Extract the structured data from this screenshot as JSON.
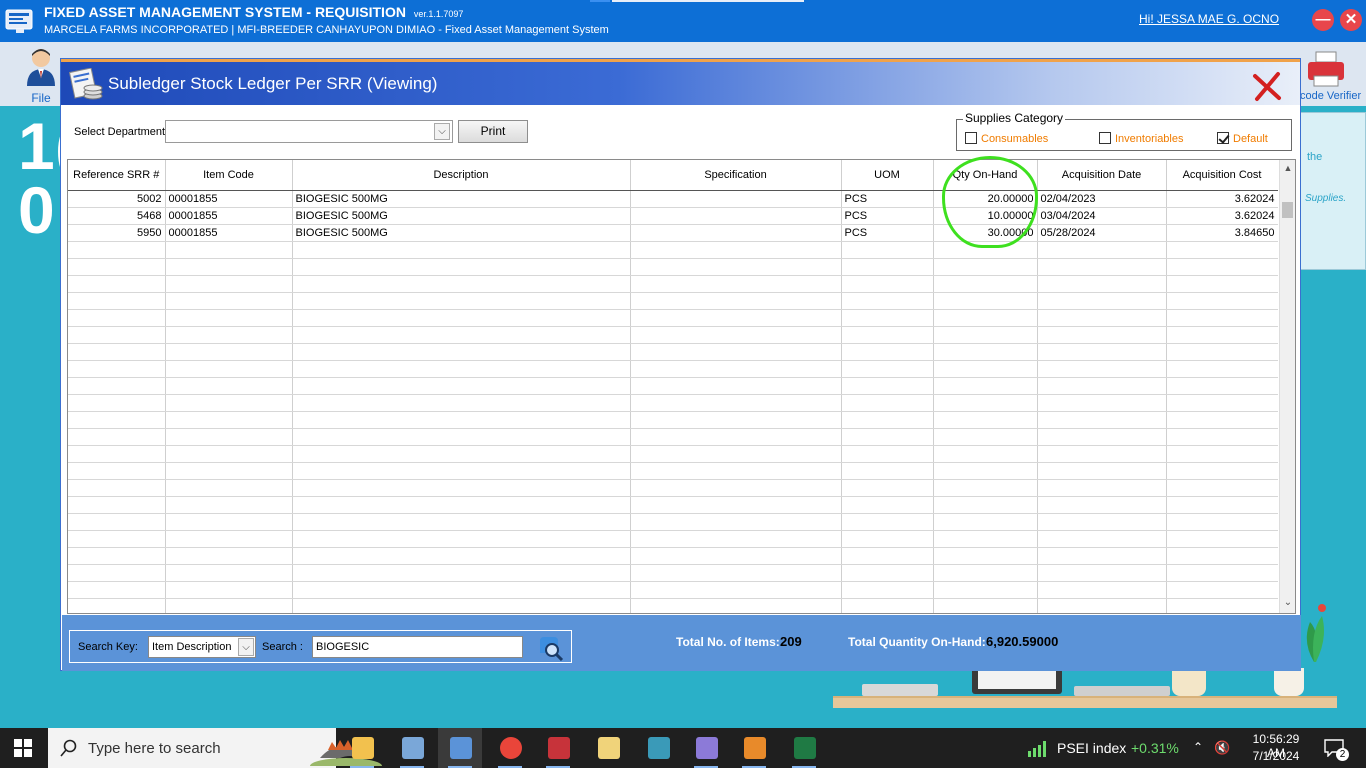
{
  "app": {
    "title": "FIXED ASSET MANAGEMENT SYSTEM - REQUISITION",
    "version": "ver.1.1.7097",
    "subtitle": "MARCELA FARMS INCORPORATED | MFI-BREEDER CANHAYUPON DIMIAO - Fixed Asset Management System",
    "greeting": "Hi! JESSA MAE G. OCNO",
    "minimize_glyph": "—",
    "close_glyph": "✕"
  },
  "ribbon": {
    "file_label": "File",
    "right_label": "code Verifier"
  },
  "background": {
    "num_1": "1(",
    "num_2": "0",
    "hint_1": "the",
    "hint_2": "Supplies."
  },
  "modal": {
    "title": "Subledger Stock Ledger Per SRR (Viewing)",
    "department_label": "Select Department",
    "department_value": "",
    "print_label": "Print",
    "category": {
      "legend": "Supplies Category",
      "consumables": "Consumables",
      "inventoriables": "Inventoriables",
      "default": "Default",
      "consumables_checked": false,
      "inventoriables_checked": false,
      "default_checked": true
    },
    "columns": [
      "Reference SRR #",
      "Item Code",
      "Description",
      "Specification",
      "UOM",
      "Qty On-Hand",
      "Acquisition Date",
      "Acquisition Cost"
    ],
    "rows": [
      [
        "5002",
        "00001855",
        "BIOGESIC 500MG",
        "",
        "PCS",
        "20.00000",
        "02/04/2023",
        "3.62024"
      ],
      [
        "5468",
        "00001855",
        "BIOGESIC 500MG",
        "",
        "PCS",
        "10.00000",
        "03/04/2024",
        "3.62024"
      ],
      [
        "5950",
        "00001855",
        "BIOGESIC 500MG",
        "",
        "PCS",
        "30.00000",
        "05/28/2024",
        "3.84650"
      ]
    ],
    "empty_rows": 22,
    "footer": {
      "search_key_label": "Search Key:",
      "search_key_value": "Item Description",
      "search_label": "Search :",
      "search_value": "BIOGESIC",
      "total_items_label": "Total No. of Items:",
      "total_items_value": "209",
      "total_qty_label": "Total Quantity On-Hand:",
      "total_qty_value": "6,920.59000"
    }
  },
  "taskbar": {
    "search_placeholder": "Type here to search",
    "psei_label": "PSEI index",
    "psei_change": "+0.31%",
    "tray_arrow": "⌃",
    "speaker": "🔇",
    "time": "10:56:29 AM",
    "date": "7/1/2024",
    "notification_count": "2",
    "apps": [
      {
        "name": "file-explorer",
        "color": "#f2c14e"
      },
      {
        "name": "image-viewer",
        "color": "#7aa7d8"
      },
      {
        "name": "fixed-asset-app",
        "color": "#5b93d8"
      },
      {
        "name": "chrome",
        "color": "#e9453a"
      },
      {
        "name": "app-red",
        "color": "#c7333a"
      },
      {
        "name": "notes",
        "color": "#f0d37a"
      },
      {
        "name": "app-teal",
        "color": "#3a9ab8"
      },
      {
        "name": "network",
        "color": "#8c7ad8"
      },
      {
        "name": "app-colorful",
        "color": "#e88a2a"
      },
      {
        "name": "excel",
        "color": "#1f7a44"
      }
    ]
  }
}
